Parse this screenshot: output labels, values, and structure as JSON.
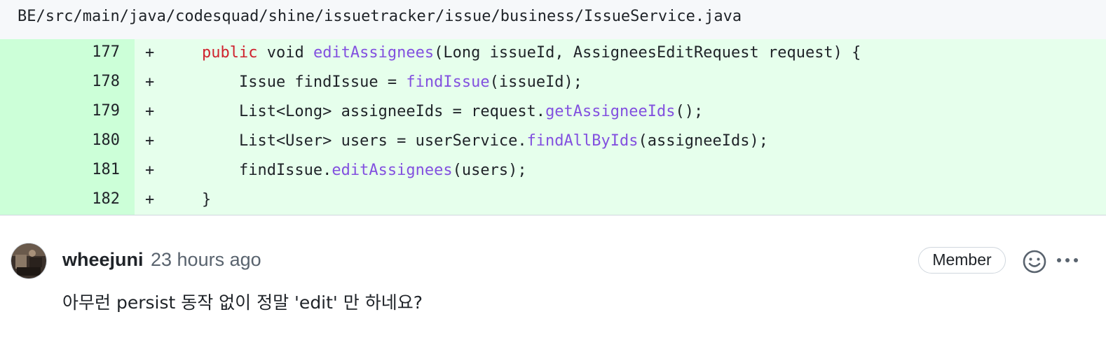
{
  "file": {
    "path": "BE/src/main/java/codesquad/shine/issuetracker/issue/business/IssueService.java"
  },
  "diff": {
    "lines": [
      {
        "number": "177",
        "marker": "+",
        "tokens": [
          {
            "text": "    "
          },
          {
            "text": "public",
            "type": "keyword"
          },
          {
            "text": " void "
          },
          {
            "text": "editAssignees",
            "type": "function"
          },
          {
            "text": "(Long issueId, AssigneesEditRequest request) {"
          }
        ]
      },
      {
        "number": "178",
        "marker": "+",
        "tokens": [
          {
            "text": "        Issue findIssue = "
          },
          {
            "text": "findIssue",
            "type": "function"
          },
          {
            "text": "(issueId);"
          }
        ]
      },
      {
        "number": "179",
        "marker": "+",
        "tokens": [
          {
            "text": "        List<Long> assigneeIds = request."
          },
          {
            "text": "getAssigneeIds",
            "type": "function"
          },
          {
            "text": "();"
          }
        ]
      },
      {
        "number": "180",
        "marker": "+",
        "tokens": [
          {
            "text": "        List<User> users = userService."
          },
          {
            "text": "findAllByIds",
            "type": "function"
          },
          {
            "text": "(assigneeIds);"
          }
        ]
      },
      {
        "number": "181",
        "marker": "+",
        "tokens": [
          {
            "text": "        findIssue."
          },
          {
            "text": "editAssignees",
            "type": "function"
          },
          {
            "text": "(users);"
          }
        ]
      },
      {
        "number": "182",
        "marker": "+",
        "tokens": [
          {
            "text": "    }"
          }
        ]
      }
    ]
  },
  "comment": {
    "author": "wheejuni",
    "timestamp": "23 hours ago",
    "badge": "Member",
    "body": "아무런 persist 동작 없이 정말 'edit' 만 하네요?"
  },
  "colors": {
    "added_line_bg": "#e6ffec",
    "added_gutter_bg": "#ccffd8",
    "keyword": "#cf222e",
    "function": "#8250df"
  },
  "icons": {
    "reaction": "smiley-icon",
    "more": "kebab-horizontal-icon"
  }
}
